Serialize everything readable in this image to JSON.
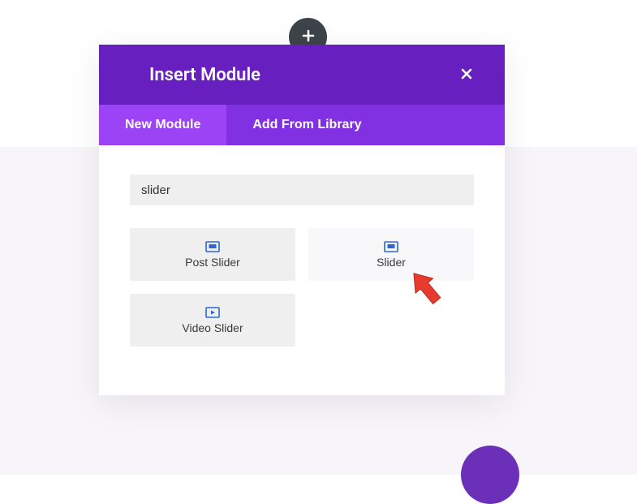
{
  "modal": {
    "title": "Insert Module",
    "tabs": {
      "new_module": "New Module",
      "add_from_library": "Add From Library"
    },
    "search_value": "slider",
    "modules": {
      "post_slider": "Post Slider",
      "slider": "Slider",
      "video_slider": "Video Slider"
    }
  },
  "colors": {
    "header_bg": "#681fbf",
    "tabs_bg": "#8131e2",
    "tab_active_bg": "#9b43f5",
    "icon_color": "#2a68d8"
  }
}
